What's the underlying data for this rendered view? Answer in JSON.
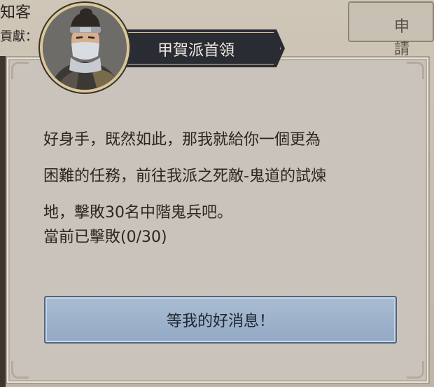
{
  "background": {
    "top_left_text": "知客",
    "top_left_text2": "貢獻：",
    "apply_button_label": "申 請"
  },
  "npc": {
    "name": "甲賀派首領",
    "portrait_icon": "ninja-leader-portrait"
  },
  "dialog": {
    "message": "好身手，既然如此，那我就給你一個更為\n困難的任務，前往我派之死敵-鬼道的試煉\n地，擊敗30名中階鬼兵吧。",
    "progress_text": "當前已擊敗(0/30)",
    "kills_done": 0,
    "kills_required": 30,
    "confirm_label": "等我的好消息！"
  },
  "colors": {
    "dialog_bg": "#c9c3bb",
    "button_bg": "#9fb3cb",
    "title_plate": "#2a2c33"
  }
}
